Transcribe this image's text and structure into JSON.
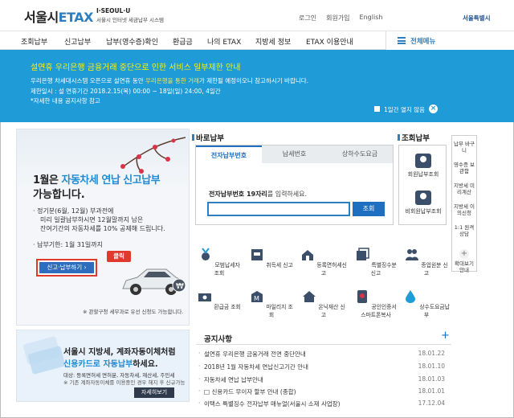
{
  "header": {
    "logo_main": "서울시",
    "logo_etax": "ETAX",
    "seoul_brand": "I·SEOUL·U",
    "seoul_sub": "서울시 인터넷 세금납부 시스템",
    "util": [
      "로그인",
      "회원가입",
      "English"
    ],
    "city": "서울특별시"
  },
  "nav": {
    "items": [
      "조회납부",
      "신고납부",
      "납부(영수증)확인",
      "환급금",
      "나의 ETAX",
      "지방세 정보",
      "ETAX 이용안내"
    ],
    "menu_label": "전체메뉴"
  },
  "notice": {
    "title": "설연휴 우리은행 금융거래 중단으로 인한 서비스 일부제한 안내",
    "line1_a": "우리은행 차세대시스템 오픈으로 설연휴 동안 ",
    "line1_hl": "우리은행을 통한 거래",
    "line1_b": "가 제한될 예정이오니 참고하시기 바랍니다.",
    "line2": "제한일시 : 설 연휴기간 2018.2.15(목) 00:00 ~ 18일(일) 24:00, 4일간",
    "line3": "*자세한 내용 공지사항 참고",
    "checkbox_label": "1일간 열지 않음",
    "close": "×"
  },
  "left_banner": {
    "title_a": "1월은 ",
    "title_b": "자동차세 연납 신고납부",
    "title_c": "가 능합니다.",
    "title_line2": "가능합니다.",
    "bullet1": "· 정기분(6월, 12월) 부과전에",
    "bullet1b": "미리 일괄납부하시면 12월말까지 남은",
    "bullet1c": "잔여기간의 자동차세를 10% 공제해 드립니다.",
    "bullet2": "· 납부기한: 1월 31일까지",
    "button": "신고·납부하기 ›",
    "click": "클릭",
    "note": "※ 관할구청 세무과로 유선 신청도 가능합니다.",
    "dots": "◀ ▶ ■ ⏸"
  },
  "left_banner2": {
    "t1": "서울시 지방세, 계좌자동이체처럼",
    "t2_a": "신용카드로 자동납부",
    "t2_b": "하세요.",
    "s1": "대상: 등록면허세 면허분, 자동차세, 재산세, 주민세",
    "s2": "※ 기존 계좌자동이체를 이용중인 경우 해지 후 신규가능",
    "button": "자세히보기"
  },
  "bar_payment": {
    "title": "바로납부",
    "tabs": [
      "전자납부번호",
      "납세번호",
      "상하수도요금"
    ],
    "label_a": "전자납부번호 19자리",
    "label_b": "를 입력하세요.",
    "search": "조회",
    "input_value": ""
  },
  "inquiry": {
    "title": "조회납부",
    "items": [
      "회원납부조회",
      "비회원납부조회"
    ]
  },
  "side": {
    "items": [
      "납부\n바구니",
      "영수증\n보관함",
      "지방세\n미리계산",
      "지방세\n이의신청",
      "1:1 원격\n상담"
    ],
    "plus": "+",
    "more": "확대보기\n안내"
  },
  "grid": {
    "items": [
      "모범납세자 조회",
      "취득세 신고",
      "등록면허세신고",
      "특별징수분 신고",
      "종업원분 신고",
      "환급금 조회",
      "마일리지 조회",
      "온닉재산 신고",
      "공인인증서\n스마트폰복사",
      "상수도요금납부"
    ]
  },
  "notice_list": {
    "title": "공지사항",
    "plus": "+",
    "rows": [
      {
        "text": "설연휴 우리은행 금융거래 전면 중단안내",
        "date": "18.01.22"
      },
      {
        "text": "2018년 1월 자동차세 연납신고기간 안내",
        "date": "18.01.10"
      },
      {
        "text": "자동차세 연납 납부안내",
        "date": "18.01.03"
      },
      {
        "text": "□ 신용카드 무이자 할부 안내 (종합)",
        "date": "18.01.01"
      },
      {
        "text": "이택스 특별징수 전자납부 매뉴얼(서울시 소재 사업장)",
        "date": "17.12.04"
      }
    ]
  }
}
